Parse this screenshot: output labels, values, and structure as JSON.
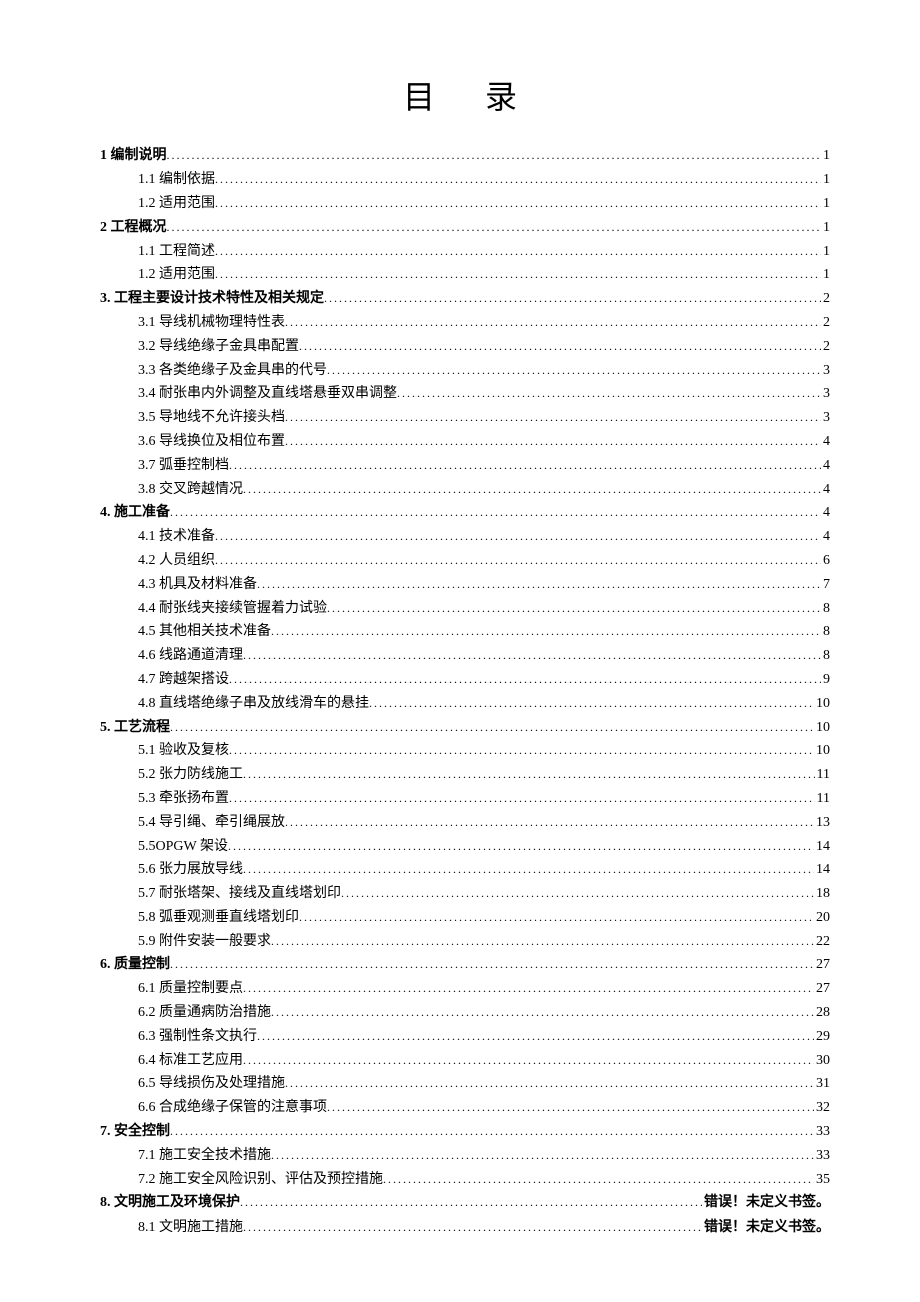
{
  "title": "目录",
  "toc": [
    {
      "level": 1,
      "label": "1 编制说明",
      "page": "1"
    },
    {
      "level": 2,
      "label": "1.1 编制依据",
      "page": "1"
    },
    {
      "level": 2,
      "label": "1.2 适用范围",
      "page": "1"
    },
    {
      "level": 1,
      "label": "2 工程概况",
      "page": "1"
    },
    {
      "level": 2,
      "label": "1.1 工程简述",
      "page": "1"
    },
    {
      "level": 2,
      "label": "1.2 适用范围",
      "page": "1"
    },
    {
      "level": 1,
      "label": "3. 工程主要设计技术特性及相关规定",
      "page": "2"
    },
    {
      "level": 2,
      "label": "3.1 导线机械物理特性表",
      "page": "2"
    },
    {
      "level": 2,
      "label": "3.2 导线绝缘子金具串配置",
      "page": "2"
    },
    {
      "level": 2,
      "label": "3.3 各类绝缘子及金具串的代号",
      "page": "3"
    },
    {
      "level": 2,
      "label": "3.4 耐张串内外调整及直线塔悬垂双串调整",
      "page": "3"
    },
    {
      "level": 2,
      "label": "3.5 导地线不允许接头档",
      "page": "3"
    },
    {
      "level": 2,
      "label": "3.6 导线换位及相位布置",
      "page": "4"
    },
    {
      "level": 2,
      "label": "3.7 弧垂控制档",
      "page": "4"
    },
    {
      "level": 2,
      "label": "3.8 交叉跨越情况",
      "page": "4"
    },
    {
      "level": 1,
      "label": "4. 施工准备",
      "page": "4"
    },
    {
      "level": 2,
      "label": "4.1 技术准备",
      "page": "4"
    },
    {
      "level": 2,
      "label": "4.2 人员组织",
      "page": "6"
    },
    {
      "level": 2,
      "label": "4.3 机具及材料准备",
      "page": "7"
    },
    {
      "level": 2,
      "label": "4.4 耐张线夹接续管握着力试验",
      "page": "8"
    },
    {
      "level": 2,
      "label": "4.5 其他相关技术准备",
      "page": "8"
    },
    {
      "level": 2,
      "label": "4.6 线路通道清理",
      "page": "8"
    },
    {
      "level": 2,
      "label": "4.7 跨越架搭设",
      "page": "9"
    },
    {
      "level": 2,
      "label": "4.8 直线塔绝缘子串及放线滑车的悬挂",
      "page": "10"
    },
    {
      "level": 1,
      "label": "5.  工艺流程",
      "page": "10"
    },
    {
      "level": 2,
      "label": "5.1 验收及复核",
      "page": "10"
    },
    {
      "level": 2,
      "label": "5.2 张力防线施工",
      "page": "11"
    },
    {
      "level": 2,
      "label": "5.3 牵张扬布置",
      "page": "11"
    },
    {
      "level": 2,
      "label": "5.4 导引绳、牵引绳展放",
      "page": "13"
    },
    {
      "level": 2,
      "label": "5.5OPGW 架设",
      "page": "14"
    },
    {
      "level": 2,
      "label": "5.6 张力展放导线",
      "page": "14"
    },
    {
      "level": 2,
      "label": "5.7 耐张塔架、接线及直线塔划印",
      "page": "18"
    },
    {
      "level": 2,
      "label": "5.8 弧垂观测垂直线塔划印",
      "page": "20"
    },
    {
      "level": 2,
      "label": "5.9 附件安装一般要求",
      "page": "22"
    },
    {
      "level": 1,
      "label": "6.  质量控制",
      "page": "27"
    },
    {
      "level": 2,
      "label": "6.1 质量控制要点",
      "page": "27"
    },
    {
      "level": 2,
      "label": "6.2 质量通病防治措施",
      "page": "28"
    },
    {
      "level": 2,
      "label": "6.3 强制性条文执行",
      "page": "29"
    },
    {
      "level": 2,
      "label": "6.4 标准工艺应用",
      "page": "30"
    },
    {
      "level": 2,
      "label": "6.5 导线损伤及处理措施",
      "page": "31"
    },
    {
      "level": 2,
      "label": "6.6 合成绝缘子保管的注意事项",
      "page": "32"
    },
    {
      "level": 1,
      "label": "7.  安全控制",
      "page": "33"
    },
    {
      "level": 2,
      "label": "7.1 施工安全技术措施",
      "page": "33"
    },
    {
      "level": 2,
      "label": "7.2 施工安全风险识别、评估及预控措施",
      "page": "35"
    },
    {
      "level": 1,
      "label": "8.  文明施工及环境保护",
      "page": "错误！未定义书签。",
      "error": true
    },
    {
      "level": 2,
      "label": "8.1 文明施工措施",
      "page": "错误！未定义书签。",
      "error": true
    }
  ]
}
